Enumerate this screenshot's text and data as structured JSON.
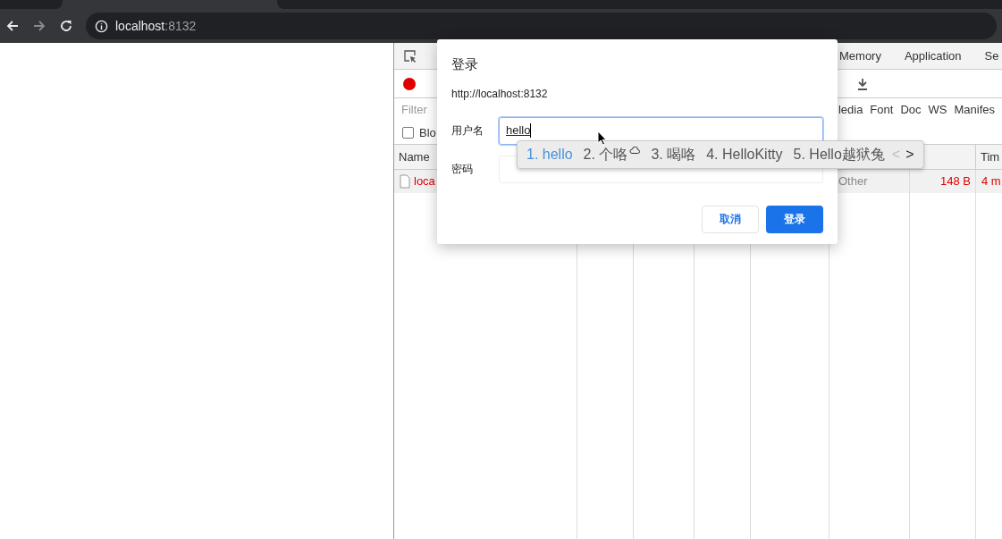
{
  "browser": {
    "url_host": "localhost",
    "url_port": ":8132"
  },
  "devtools": {
    "tabs": [
      {
        "label": "Memory",
        "selected": false
      },
      {
        "label": "Application",
        "selected": false
      },
      {
        "label": "Se",
        "selected": false
      }
    ],
    "recording": true,
    "filter_placeholder": "Filter",
    "type_filters": [
      "ledia",
      "Font",
      "Doc",
      "WS",
      "Manifes"
    ],
    "block_checkbox": {
      "label": "Blo",
      "checked": false
    },
    "columns": [
      "Name",
      "Tim"
    ],
    "rows": [
      {
        "name": "loca",
        "type": "Other",
        "size": "148 B",
        "time": "4 m",
        "failed": true
      }
    ]
  },
  "dialog": {
    "title": "登录",
    "origin": "http://localhost:8132",
    "fields": [
      {
        "label": "用户名",
        "value": "hello",
        "focused": true
      },
      {
        "label": "密码",
        "focused": false
      }
    ],
    "buttons": [
      {
        "label": "取消",
        "kind": "secondary"
      },
      {
        "label": "登录",
        "kind": "primary"
      }
    ]
  },
  "ime": {
    "candidates": [
      {
        "text": "1. hello",
        "selected": true
      },
      {
        "text": "2. 个咯",
        "selected": false
      },
      {
        "text": "3. 喝咯",
        "selected": false
      },
      {
        "text": "4. HelloKitty",
        "selected": false
      },
      {
        "text": "5. Hello越狱兔",
        "selected": false
      }
    ],
    "prev": {
      "text": "<",
      "disabled": true
    },
    "next": {
      "text": ">",
      "disabled": false
    }
  }
}
